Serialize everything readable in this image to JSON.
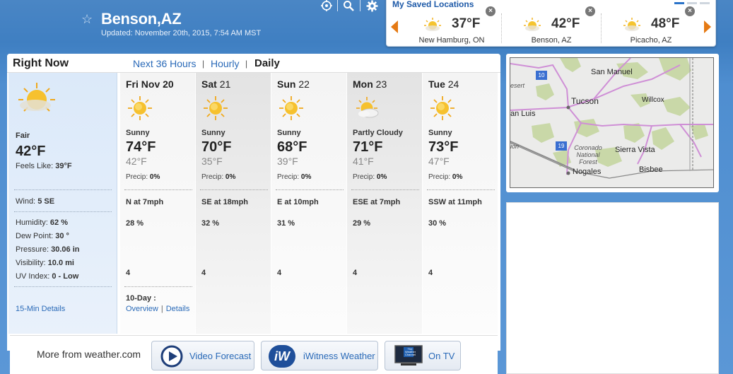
{
  "header": {
    "city": "Benson,AZ",
    "updated": "Updated: November 20th, 2015, 7:54 AM MST"
  },
  "saved": {
    "title": "My Saved Locations",
    "locations": [
      {
        "temp": "37°F",
        "name": "New Hamburg, ON"
      },
      {
        "temp": "42°F",
        "name": "Benson, AZ"
      },
      {
        "temp": "48°F",
        "name": "Picacho, AZ"
      }
    ]
  },
  "tabs": {
    "right_now": "Right Now",
    "next36": "Next 36 Hours",
    "hourly": "Hourly",
    "daily": "Daily",
    "sep": "|"
  },
  "right_now": {
    "condition": "Fair",
    "temp": "42°F",
    "feels_label": "Feels Like:",
    "feels_value": "39°F",
    "wind_label": "Wind:",
    "wind_value": "5 SE",
    "humidity_label": "Humidity:",
    "humidity_value": "62 %",
    "dew_label": "Dew Point:",
    "dew_value": "30 °",
    "pressure_label": "Pressure:",
    "pressure_value": "30.06 in",
    "visibility_label": "Visibility:",
    "visibility_value": "10.0 mi",
    "uv_label": "UV Index:",
    "uv_value": "0 - Low",
    "details_link": "15-Min Details"
  },
  "days": [
    {
      "day": "Fri",
      "date": "Nov 20",
      "condition": "Sunny",
      "hi": "74°F",
      "lo": "42°F",
      "precip_label": "Precip:",
      "precip": "0%",
      "wind": "N at 7mph",
      "humidity": "28 %",
      "uv": "4",
      "icon": "sun-icon"
    },
    {
      "day": "Sat",
      "date": "21",
      "condition": "Sunny",
      "hi": "70°F",
      "lo": "35°F",
      "precip_label": "Precip:",
      "precip": "0%",
      "wind": "SE at 18mph",
      "humidity": "32 %",
      "uv": "4",
      "icon": "sun-icon"
    },
    {
      "day": "Sun",
      "date": "22",
      "condition": "Sunny",
      "hi": "68°F",
      "lo": "39°F",
      "precip_label": "Precip:",
      "precip": "0%",
      "wind": "E at 10mph",
      "humidity": "31 %",
      "uv": "4",
      "icon": "sun-icon"
    },
    {
      "day": "Mon",
      "date": "23",
      "condition": "Partly Cloudy",
      "hi": "71°F",
      "lo": "41°F",
      "precip_label": "Precip:",
      "precip": "0%",
      "wind": "ESE at 7mph",
      "humidity": "29 %",
      "uv": "4",
      "icon": "partly-cloudy-icon"
    },
    {
      "day": "Tue",
      "date": "24",
      "condition": "Sunny",
      "hi": "73°F",
      "lo": "47°F",
      "precip_label": "Precip:",
      "precip": "0%",
      "wind": "SSW at 11mph",
      "humidity": "30 %",
      "uv": "4",
      "icon": "sun-icon"
    }
  ],
  "ten_day": {
    "label": "10-Day :",
    "overview": "Overview",
    "sep": "|",
    "details": "Details"
  },
  "more": {
    "title": "More from weather.com",
    "video": "Video Forecast",
    "iwitness": "iWitness Weather",
    "iwitness_logo": "iW",
    "ontv": "On TV",
    "tv_logo": "The Weather Channel"
  },
  "map": {
    "labels": [
      "San Manuel",
      "Tucson",
      "Willcox",
      "Coronado National Forest",
      "Sierra Vista",
      "Nogales",
      "Bisbee",
      "an Luis",
      "esert",
      "ion",
      "10",
      "19"
    ]
  },
  "colors": {
    "accent": "#2a6ab8",
    "brand_blue": "#4a86c5",
    "orange": "#e57a14"
  }
}
